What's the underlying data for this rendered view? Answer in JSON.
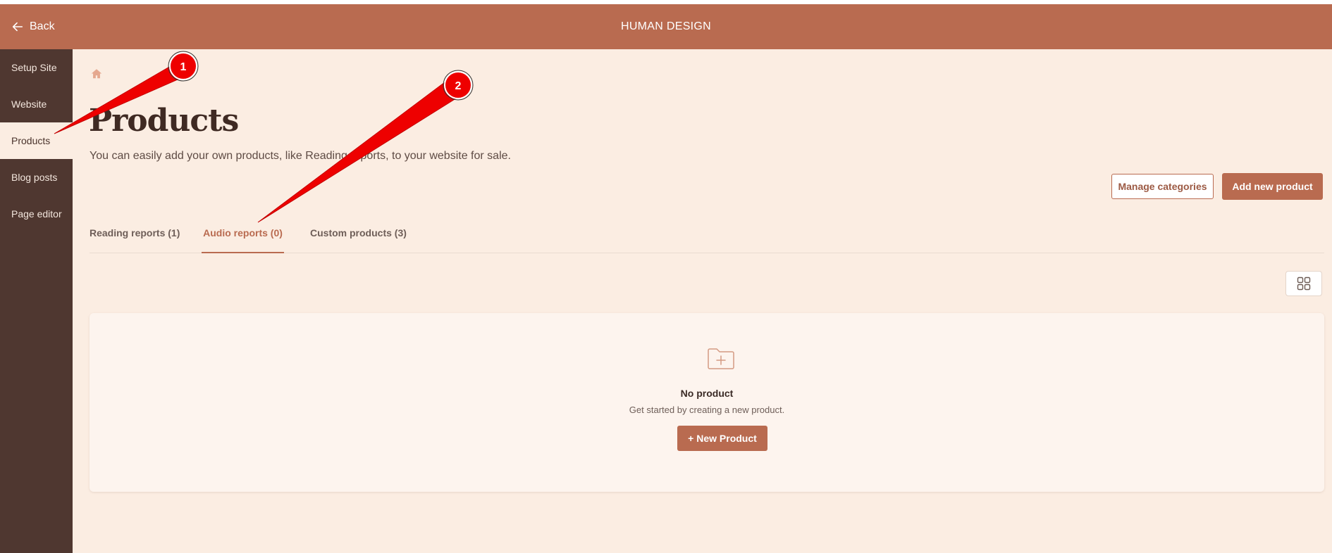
{
  "header": {
    "back_label": "Back",
    "app_title": "HUMAN DESIGN"
  },
  "sidebar": {
    "items": [
      {
        "label": "Setup Site"
      },
      {
        "label": "Website"
      },
      {
        "label": "Products"
      },
      {
        "label": "Blog posts"
      },
      {
        "label": "Page editor"
      }
    ],
    "active_item": "Products"
  },
  "page": {
    "title": "Products",
    "subtitle": "You can easily add your own products, like Reading reports, to your website for sale.",
    "manage_categories_label": "Manage categories",
    "add_product_label": "Add new product"
  },
  "tabs": [
    {
      "label": "Reading reports (1)"
    },
    {
      "label": "Audio reports (0)"
    },
    {
      "label": "Custom products (3)"
    }
  ],
  "active_tab": "Audio reports (0)",
  "empty_state": {
    "title": "No product",
    "description": "Get started by creating a new product.",
    "button_label": "+ New Product"
  },
  "annotations": {
    "markers": [
      {
        "label": "1"
      },
      {
        "label": "2"
      }
    ]
  },
  "colors": {
    "brand": "#b96b50",
    "sidebar_bg": "#4f3730",
    "page_bg": "#fbede2",
    "annotation": "#ee0000"
  }
}
